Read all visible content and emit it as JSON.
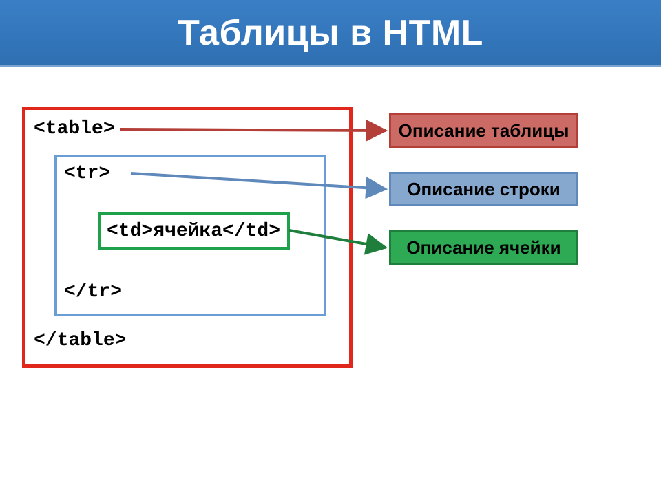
{
  "title": "Таблицы в HTML",
  "code": {
    "table_open": "<table>",
    "table_close": "</table>",
    "tr_open": "<tr>",
    "tr_close": "</tr>",
    "td_line": "<td>ячейка</td>"
  },
  "labels": {
    "table": "Описание таблицы",
    "row": "Описание строки",
    "cell": "Описание ячейки"
  },
  "colors": {
    "banner": "#3a7fc6",
    "red": "#e1261c",
    "blue": "#6a9dd4",
    "green": "#1fa04a"
  }
}
